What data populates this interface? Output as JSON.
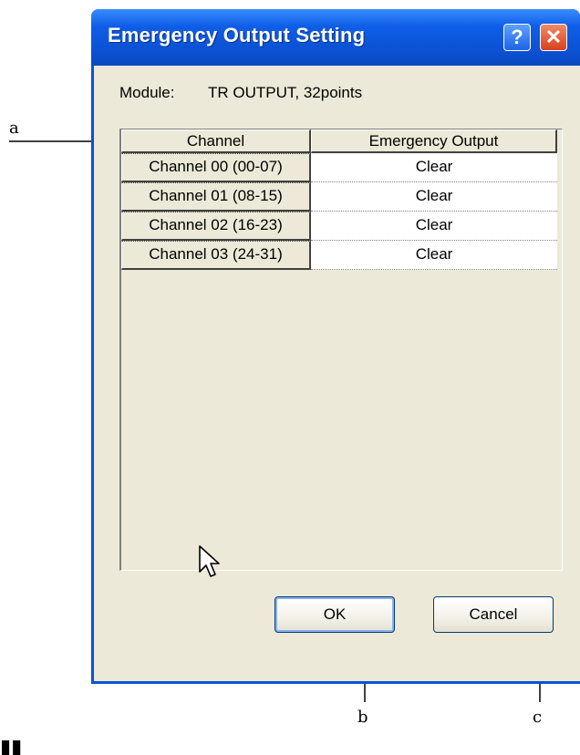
{
  "dialog": {
    "title": "Emergency Output Setting",
    "help_glyph": "?",
    "close_glyph": "✕",
    "module_label": "Module:",
    "module_value": "TR OUTPUT, 32points",
    "grid": {
      "columns": [
        "Channel",
        "Emergency Output"
      ],
      "rows": [
        {
          "channel": "Channel 00 (00-07)",
          "output": "Clear"
        },
        {
          "channel": "Channel 01 (08-15)",
          "output": "Clear"
        },
        {
          "channel": "Channel 02 (16-23)",
          "output": "Clear"
        },
        {
          "channel": "Channel 03 (24-31)",
          "output": "Clear"
        }
      ]
    },
    "ok_label": "OK",
    "cancel_label": "Cancel"
  },
  "annotations": {
    "a": "a",
    "b": "b",
    "c": "c"
  },
  "colors": {
    "titlebar": "#0b52d4",
    "dialog_face": "#ece9d8",
    "close_button": "#d8401c"
  }
}
